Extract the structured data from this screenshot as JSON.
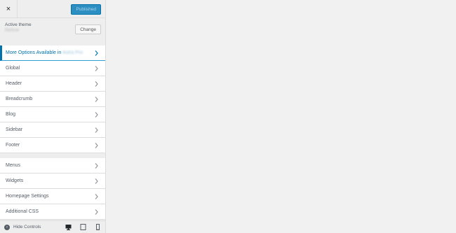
{
  "header": {
    "close_label": "×",
    "publish_label": "Published"
  },
  "theme": {
    "label": "Active theme",
    "name": "Refine",
    "change_label": "Change"
  },
  "promo": {
    "label": "More Options Available in",
    "product": "Astra Pro"
  },
  "sections_primary": [
    {
      "label": "Global"
    },
    {
      "label": "Header"
    },
    {
      "label": "Breadcrumb"
    },
    {
      "label": "Blog"
    },
    {
      "label": "Sidebar"
    },
    {
      "label": "Footer"
    }
  ],
  "sections_secondary": [
    {
      "label": "Menus"
    },
    {
      "label": "Widgets"
    },
    {
      "label": "Homepage Settings"
    },
    {
      "label": "Additional CSS"
    }
  ],
  "footer": {
    "hide_controls_label": "Hide Controls",
    "devices": [
      "desktop-icon",
      "tablet-icon",
      "mobile-icon"
    ]
  },
  "colors": {
    "accent": "#0073aa",
    "publish_bg": "#2d8fc1",
    "sidebar_bg": "#eeeeee",
    "preview_bg": "#f1f1f1"
  }
}
